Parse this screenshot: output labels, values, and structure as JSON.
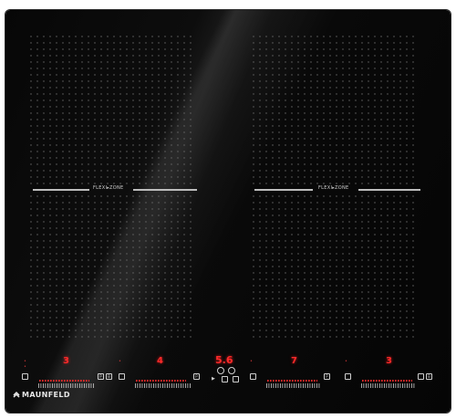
{
  "zones": [
    {
      "flex_label": "FLEXI▸ZONE"
    },
    {
      "flex_label": "FLEXI▸ZONE"
    }
  ],
  "controls": [
    {
      "level": "3"
    },
    {
      "level": "4"
    },
    {
      "level": "5.6"
    },
    {
      "level": "7"
    },
    {
      "level": "3"
    }
  ],
  "panel_icons": {
    "left_p": "P",
    "left_b": "B",
    "mid_p": "P",
    "right_p": "P",
    "right_b": "B"
  },
  "brand": {
    "name": "MAUNFELD"
  },
  "colors": {
    "glass": "#0a0a0a",
    "dots": "#6a6a6a",
    "display": "#ff2a2a",
    "text": "#cfcfcf"
  }
}
